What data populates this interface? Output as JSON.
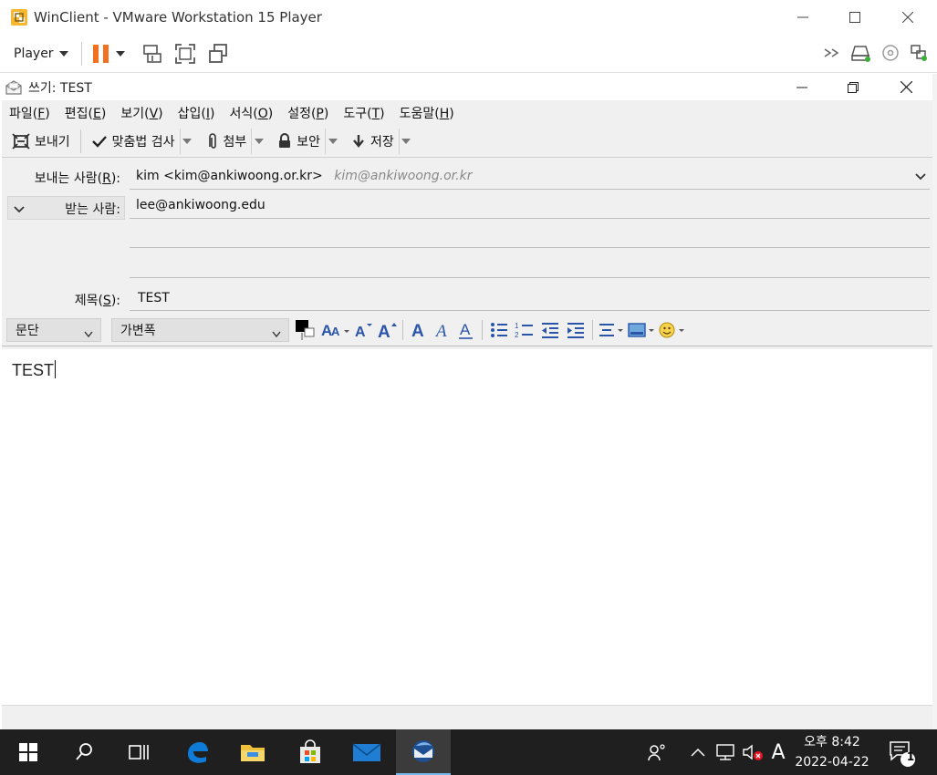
{
  "vm": {
    "title": "WinClient - VMware Workstation 15 Player",
    "player_label": "Player"
  },
  "compose": {
    "title": "쓰기: TEST",
    "menu": [
      {
        "label": "파일(",
        "key": "F",
        "end": ")"
      },
      {
        "label": "편집(",
        "key": "E",
        "end": ")"
      },
      {
        "label": "보기(",
        "key": "V",
        "end": ")"
      },
      {
        "label": "삽입(",
        "key": "I",
        "end": ")"
      },
      {
        "label": "서식(",
        "key": "O",
        "end": ")"
      },
      {
        "label": "설정(",
        "key": "P",
        "end": ")"
      },
      {
        "label": "도구(",
        "key": "T",
        "end": ")"
      },
      {
        "label": "도움말(",
        "key": "H",
        "end": ")"
      }
    ],
    "toolbar": {
      "send": "보내기",
      "spell": "맞춤법 검사",
      "attach": "첨부",
      "security": "보안",
      "save": "저장"
    },
    "header": {
      "from_label_pre": "보내는 사람(",
      "from_label_key": "R",
      "from_label_post": "):",
      "from_value": "kim <kim@ankiwoong.or.kr>",
      "from_hint": "kim@ankiwoong.or.kr",
      "to_label_pre": "받는 사람",
      "to_label_post": ":",
      "to_value": "lee@ankiwoong.edu",
      "subject_label_pre": "제목(",
      "subject_label_key": "S",
      "subject_label_post": "):",
      "subject_value": "TEST"
    },
    "format": {
      "paragraph": "문단",
      "font": "가변폭"
    },
    "body_text": "TEST"
  },
  "taskbar": {
    "time": "오후 8:42",
    "date": "2022-04-22",
    "ime": "A",
    "notification_count": "1"
  },
  "colors": {
    "vm_pause": "#f37021",
    "taskbar_bg": "#1f1f1f",
    "edge_blue": "#0f7bd8",
    "accent": "#2a55a8"
  }
}
